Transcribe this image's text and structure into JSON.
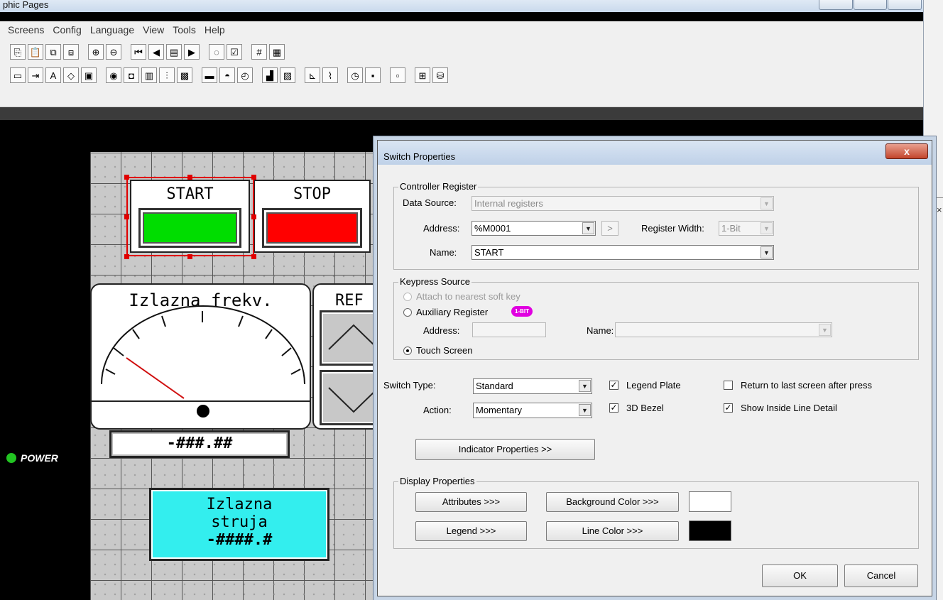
{
  "window": {
    "title": "phic Pages"
  },
  "menu": [
    "Screens",
    "Config",
    "Language",
    "View",
    "Tools",
    "Help"
  ],
  "toolbar_row1": [
    "copy-icon",
    "paste-icon",
    "bring-front-icon",
    "send-back-icon",
    "sep",
    "zoom-in-icon",
    "zoom-out-icon",
    "sep",
    "first-screen-icon",
    "prev-screen-icon",
    "screen-list-icon",
    "next-screen-icon",
    "sep",
    "comment-icon",
    "check-icon",
    "sep",
    "grid-icon",
    "grid-fine-icon"
  ],
  "toolbar_row2": [
    "password-icon",
    "data-entry-icon",
    "text-icon",
    "shape-icon",
    "bitmap-icon",
    "sep",
    "light-icon",
    "switch-icon",
    "multi-switch-icon",
    "slider-icon",
    "screen-link-icon",
    "sep",
    "bargraph-icon",
    "gauge-dome-icon",
    "dial-icon",
    "sep",
    "trend-icon",
    "chart-icon",
    "sep",
    "xy-chart-icon",
    "line-chart-icon",
    "sep",
    "timer-icon",
    "save-icon",
    "sep",
    "video-icon",
    "sep",
    "table-icon",
    "database-icon"
  ],
  "hmi": {
    "start_label": "START",
    "stop_label": "STOP",
    "gauge_title": "Izlazna frekv.",
    "ref_label": "REF",
    "freq_value": "-###.##",
    "power_label": "POWER",
    "current_line1": "Izlazna",
    "current_line2": "struja",
    "current_value": "-####.#",
    "start_color": "#00dd00",
    "stop_color": "#ff0000",
    "current_box_color": "#33eeee"
  },
  "dialog": {
    "title": "Switch Properties",
    "close": "x",
    "controller_register": {
      "legend": "Controller Register",
      "data_source_label": "Data Source:",
      "data_source_value": "Internal registers",
      "address_label": "Address:",
      "address_value": "%M0001",
      "browse_label": ">",
      "register_width_label": "Register Width:",
      "register_width_value": "1-Bit",
      "name_label": "Name:",
      "name_value": "START"
    },
    "keypress_source": {
      "legend": "Keypress Source",
      "option_soft_key": "Attach to nearest soft key",
      "option_aux": "Auxiliary Register",
      "badge": "1-BIT",
      "address_label": "Address:",
      "address_value": "",
      "name_label": "Name:",
      "name_value": "",
      "option_touch": "Touch Screen",
      "selected": "Touch Screen"
    },
    "switch_type_label": "Switch Type:",
    "switch_type_value": "Standard",
    "action_label": "Action:",
    "action_value": "Momentary",
    "legend_plate": {
      "label": "Legend Plate",
      "checked": true
    },
    "bezel_3d": {
      "label": "3D Bezel",
      "checked": true
    },
    "return_last": {
      "label": "Return to last screen after press",
      "checked": false
    },
    "inside_line": {
      "label": "Show Inside Line Detail",
      "checked": true
    },
    "indicator_button": "Indicator Properties >>",
    "display_properties": {
      "legend": "Display Properties",
      "attributes_button": "Attributes >>>",
      "background_button": "Background Color >>>",
      "background_color": "#ffffff",
      "legend_button": "Legend >>>",
      "line_color_button": "Line Color >>>",
      "line_color": "#000000"
    },
    "ok": "OK",
    "cancel": "Cancel"
  }
}
